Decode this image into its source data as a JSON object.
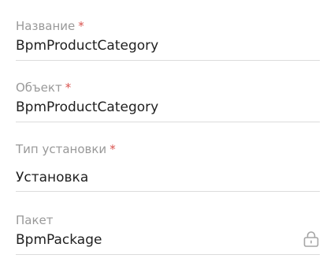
{
  "fields": [
    {
      "label": "Название",
      "required_mark": "*",
      "value": "BpmProductCategory"
    },
    {
      "label": "Объект",
      "required_mark": "*",
      "value": "BpmProductCategory"
    },
    {
      "label": "Тип установки",
      "required_mark": "*",
      "value": "Установка"
    },
    {
      "label": "Пакет",
      "value": "BpmPackage",
      "icon": "lock-icon"
    }
  ],
  "colors": {
    "label": "#999999",
    "required": "#d9534f",
    "value": "#1f1f1f",
    "underline": "#dcdcdc",
    "icon": "#a6a6a6"
  }
}
